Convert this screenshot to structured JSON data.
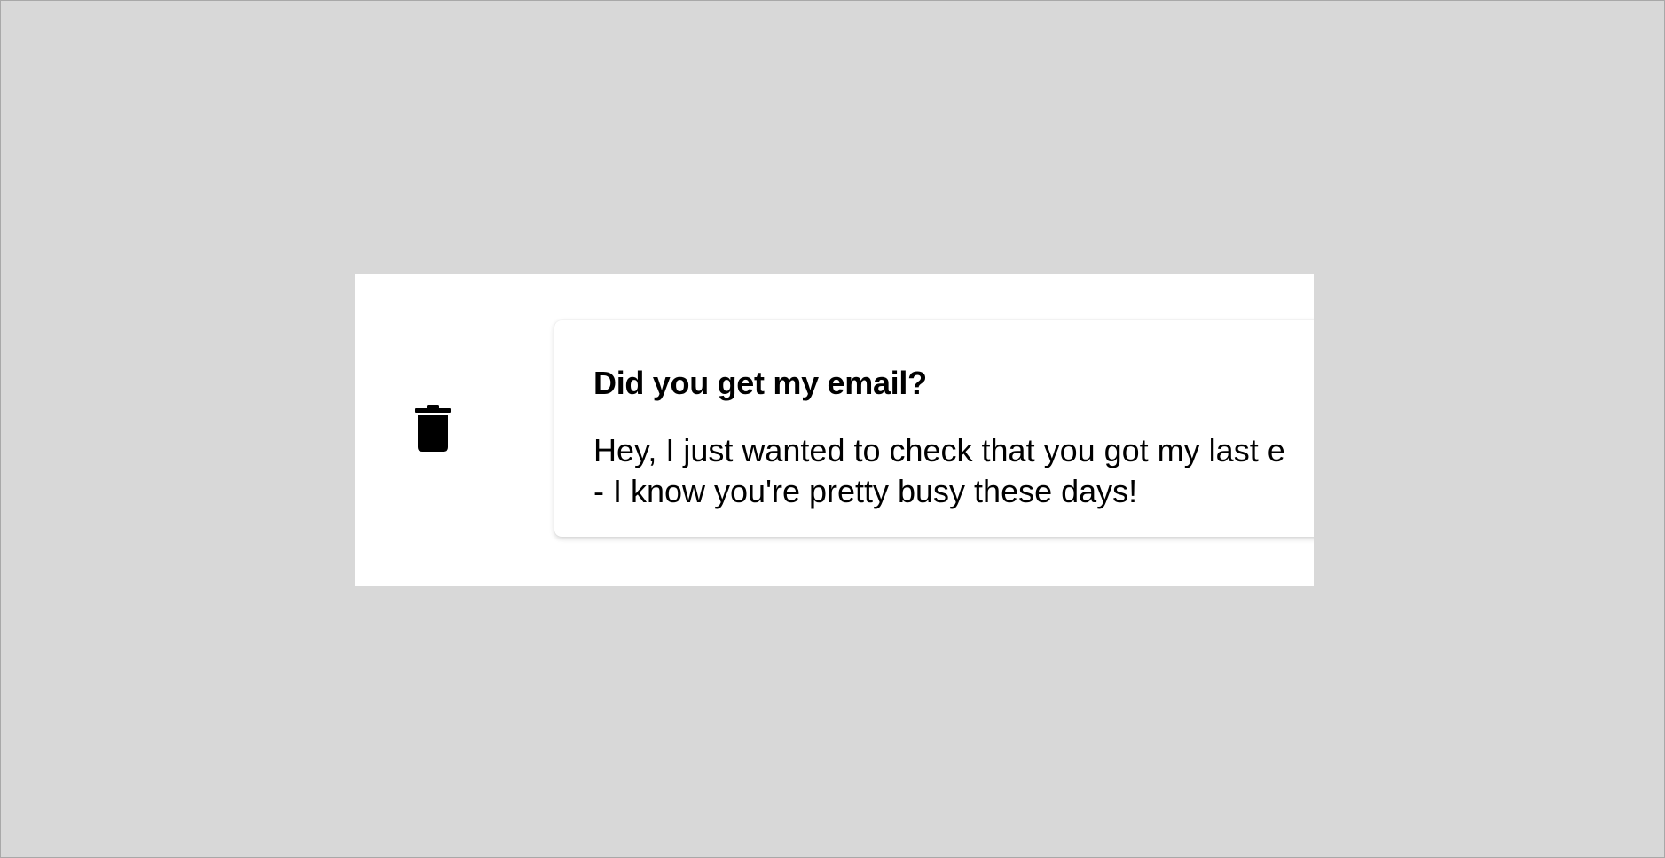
{
  "notification": {
    "title": "Did you get my email?",
    "body_line1": "Hey, I just wanted to check that you got my last e",
    "body_line2": "- I know you're pretty busy these days!"
  },
  "icons": {
    "delete": "trash-icon"
  },
  "colors": {
    "background": "#d8d8d8",
    "panel": "#ffffff",
    "text": "#000000"
  }
}
